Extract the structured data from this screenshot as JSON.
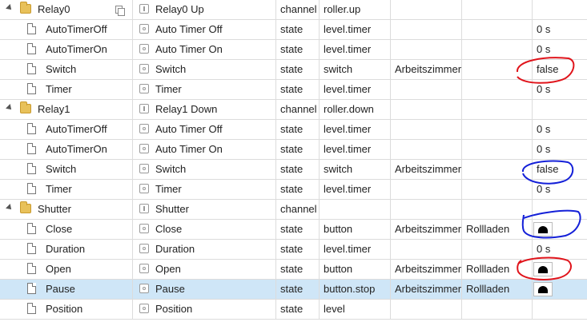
{
  "colors": {
    "selected_row": "#cfe6f7",
    "annotation_red": "#e0141b",
    "annotation_blue": "#1420d8"
  },
  "rows": [
    {
      "level": 0,
      "kind": "folder",
      "id": "Relay0",
      "name": "Relay0 Up",
      "type": "channel",
      "role": "roller.up",
      "room": "",
      "function": "",
      "value": "",
      "name_icon": "channel-icon",
      "copy": true
    },
    {
      "level": 1,
      "kind": "file",
      "id": "AutoTimerOff",
      "name": "Auto Timer Off",
      "type": "state",
      "role": "level.timer",
      "room": "",
      "function": "",
      "value": "0 s",
      "name_icon": "state-icon"
    },
    {
      "level": 1,
      "kind": "file",
      "id": "AutoTimerOn",
      "name": "Auto Timer On",
      "type": "state",
      "role": "level.timer",
      "room": "",
      "function": "",
      "value": "0 s",
      "name_icon": "state-icon"
    },
    {
      "level": 1,
      "kind": "file",
      "id": "Switch",
      "name": "Switch",
      "type": "state",
      "role": "switch",
      "room": "Arbeitszimmer",
      "function": "",
      "value": "false",
      "name_icon": "state-icon"
    },
    {
      "level": 1,
      "kind": "file",
      "id": "Timer",
      "name": "Timer",
      "type": "state",
      "role": "level.timer",
      "room": "",
      "function": "",
      "value": "0 s",
      "name_icon": "state-icon"
    },
    {
      "level": 0,
      "kind": "folder",
      "id": "Relay1",
      "name": "Relay1 Down",
      "type": "channel",
      "role": "roller.down",
      "room": "",
      "function": "",
      "value": "",
      "name_icon": "channel-icon"
    },
    {
      "level": 1,
      "kind": "file",
      "id": "AutoTimerOff",
      "name": "Auto Timer Off",
      "type": "state",
      "role": "level.timer",
      "room": "",
      "function": "",
      "value": "0 s",
      "name_icon": "state-icon"
    },
    {
      "level": 1,
      "kind": "file",
      "id": "AutoTimerOn",
      "name": "Auto Timer On",
      "type": "state",
      "role": "level.timer",
      "room": "",
      "function": "",
      "value": "0 s",
      "name_icon": "state-icon"
    },
    {
      "level": 1,
      "kind": "file",
      "id": "Switch",
      "name": "Switch",
      "type": "state",
      "role": "switch",
      "room": "Arbeitszimmer",
      "function": "",
      "value": "false",
      "name_icon": "state-icon"
    },
    {
      "level": 1,
      "kind": "file",
      "id": "Timer",
      "name": "Timer",
      "type": "state",
      "role": "level.timer",
      "room": "",
      "function": "",
      "value": "0 s",
      "name_icon": "state-icon"
    },
    {
      "level": 0,
      "kind": "folder",
      "id": "Shutter",
      "name": "Shutter",
      "type": "channel",
      "role": "",
      "room": "",
      "function": "",
      "value": "",
      "name_icon": "channel-icon"
    },
    {
      "level": 1,
      "kind": "file",
      "id": "Close",
      "name": "Close",
      "type": "state",
      "role": "button",
      "room": "Arbeitszimmer",
      "function": "Rollladen",
      "value": "",
      "value_button": true,
      "name_icon": "state-icon"
    },
    {
      "level": 1,
      "kind": "file",
      "id": "Duration",
      "name": "Duration",
      "type": "state",
      "role": "level.timer",
      "room": "",
      "function": "",
      "value": "0 s",
      "name_icon": "state-icon"
    },
    {
      "level": 1,
      "kind": "file",
      "id": "Open",
      "name": "Open",
      "type": "state",
      "role": "button",
      "room": "Arbeitszimmer",
      "function": "Rollladen",
      "value": "",
      "value_button": true,
      "name_icon": "state-icon"
    },
    {
      "level": 1,
      "kind": "file",
      "id": "Pause",
      "name": "Pause",
      "type": "state",
      "role": "button.stop",
      "room": "Arbeitszimmer",
      "function": "Rollladen",
      "value": "",
      "value_button": true,
      "selected": true,
      "name_icon": "state-icon"
    },
    {
      "level": 1,
      "kind": "file",
      "id": "Position",
      "name": "Position",
      "type": "state",
      "role": "level",
      "room": "",
      "function": "",
      "value": "",
      "name_icon": "state-icon"
    }
  ]
}
